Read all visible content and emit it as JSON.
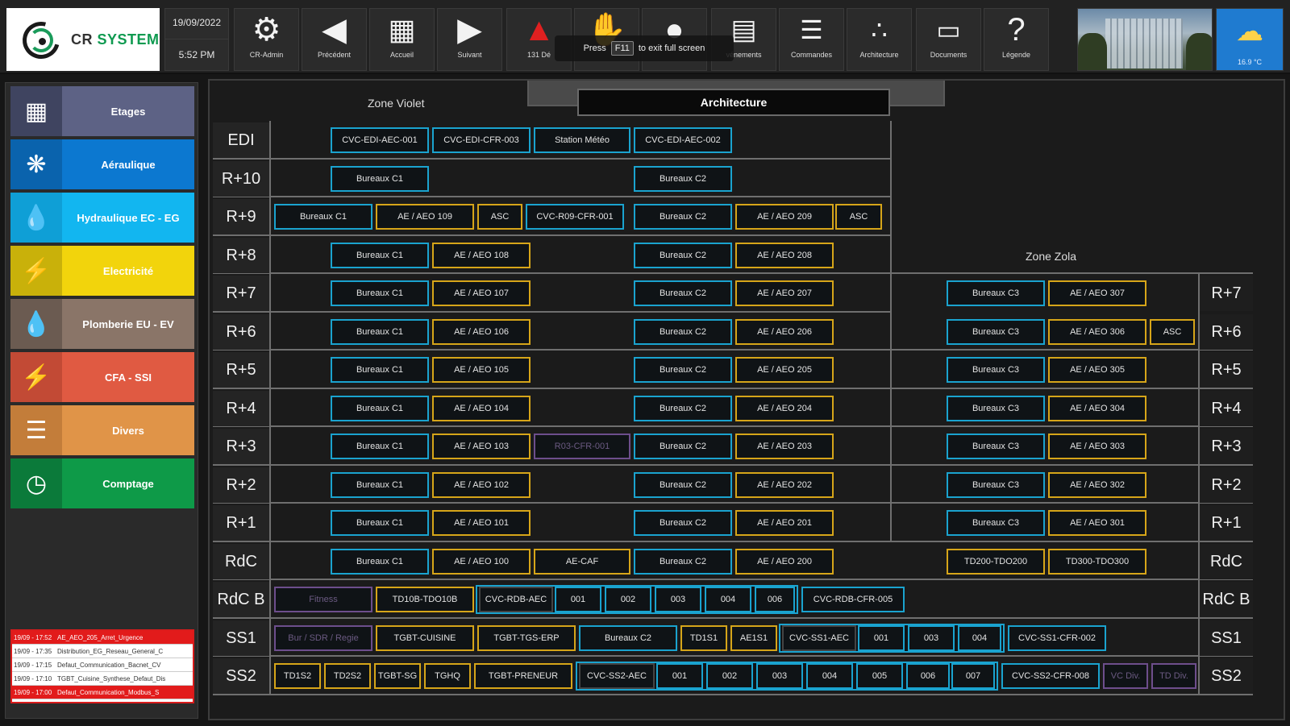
{
  "header": {
    "logo_text_cr": "CR",
    "logo_text_system": "SYSTEM",
    "date": "19/09/2022",
    "time": "5:52 PM",
    "buttons": [
      {
        "label": "CR-Admin",
        "icon": "admin-icon"
      },
      {
        "label": "Précédent",
        "icon": "back-arrow-icon"
      },
      {
        "label": "Accueil",
        "icon": "monitor-icon"
      },
      {
        "label": "Suivant",
        "icon": "forward-arrow-icon"
      },
      {
        "label": "131 Dé",
        "icon": "alarm-bell-icon"
      },
      {
        "label": "",
        "icon": "hand-icon"
      },
      {
        "label": "",
        "icon": "bell-icon"
      },
      {
        "label": "vénements",
        "icon": "clipboard-icon"
      },
      {
        "label": "Commandes",
        "icon": "sliders-icon"
      },
      {
        "label": "Architecture",
        "icon": "network-icon"
      },
      {
        "label": "Documents",
        "icon": "folder-icon"
      },
      {
        "label": "Légende",
        "icon": "question-icon"
      }
    ],
    "weather_temp": "16.9 °C",
    "f11_press": "Press",
    "f11_key": "F11",
    "f11_rest": "to exit full screen"
  },
  "sidebar": {
    "items": [
      {
        "label": "Etages",
        "icon": "building-icon",
        "icon_bg": "#3f4460",
        "bg": "#5d6285"
      },
      {
        "label": "Aéraulique",
        "icon": "fan-icon",
        "icon_bg": "#0a63ad",
        "bg": "#0c78d0"
      },
      {
        "label": "Hydraulique EC - EG",
        "icon": "drop-icon",
        "icon_bg": "#0f9fd6",
        "bg": "#12b6f0"
      },
      {
        "label": "Electricité",
        "icon": "lightning-icon",
        "icon_bg": "#c9b10a",
        "bg": "#f2d40c"
      },
      {
        "label": "Plomberie EU - EV",
        "icon": "drop-icon",
        "icon_bg": "#6b5b51",
        "bg": "#8a7568"
      },
      {
        "label": "CFA - SSI",
        "icon": "lightning-icon",
        "icon_bg": "#c24a35",
        "bg": "#e05a42"
      },
      {
        "label": "Divers",
        "icon": "list-icon",
        "icon_bg": "#c37d3a",
        "bg": "#e09448"
      },
      {
        "label": "Comptage",
        "icon": "gauge-icon",
        "icon_bg": "#0b7a3a",
        "bg": "#0e9a48"
      }
    ],
    "alarms": [
      {
        "time": "19/09 - 17:52",
        "text": "AE_AEO_205_Arret_Urgence",
        "red": true
      },
      {
        "time": "19/09 - 17:35",
        "text": "Distribution_EG_Reseau_General_C",
        "red": false
      },
      {
        "time": "19/09 - 17:15",
        "text": "Defaut_Communication_Bacnet_CV",
        "red": false
      },
      {
        "time": "19/09 - 17:10",
        "text": "TGBT_Cuisine_Synthese_Defaut_Dis",
        "red": false
      },
      {
        "time": "19/09 - 17:00",
        "text": "Defaut_Communication_Modbus_S",
        "red": true
      }
    ]
  },
  "main": {
    "tab": "Architecture",
    "zone_violet": "Zone Violet",
    "zone_zola": "Zone Zola",
    "floors": [
      "EDI",
      "R+10",
      "R+9",
      "R+8",
      "R+7",
      "R+6",
      "R+5",
      "R+4",
      "R+3",
      "R+2",
      "R+1",
      "RdC",
      "RdC B",
      "SS1",
      "SS2"
    ],
    "right_floors": [
      "R+7",
      "R+6",
      "R+5",
      "R+4",
      "R+3",
      "R+2",
      "R+1",
      "RdC",
      "RdC B",
      "SS1",
      "SS2"
    ],
    "cells": {
      "edi": [
        "CVC-EDI-AEC-001",
        "CVC-EDI-CFR-003",
        "Station Météo",
        "CVC-EDI-AEC-002"
      ],
      "r10": [
        "Bureaux C1",
        "Bureaux C2"
      ],
      "r9": [
        "Bureaux C1",
        "AE / AEO 109",
        "ASC",
        "CVC-R09-CFR-001",
        "Bureaux C2",
        "AE / AEO 209",
        "ASC"
      ],
      "r8": [
        "Bureaux C1",
        "AE / AEO 108",
        "Bureaux C2",
        "AE / AEO 208"
      ],
      "r7": [
        "Bureaux C1",
        "AE / AEO 107",
        "Bureaux C2",
        "AE / AEO 207",
        "Bureaux C3",
        "AE / AEO 307"
      ],
      "r6": [
        "Bureaux C1",
        "AE / AEO 106",
        "Bureaux C2",
        "AE / AEO 206",
        "Bureaux C3",
        "AE / AEO 306",
        "ASC"
      ],
      "r5": [
        "Bureaux C1",
        "AE / AEO 105",
        "Bureaux C2",
        "AE / AEO 205",
        "Bureaux C3",
        "AE / AEO 305"
      ],
      "r4": [
        "Bureaux C1",
        "AE / AEO 104",
        "Bureaux C2",
        "AE / AEO 204",
        "Bureaux C3",
        "AE / AEO 304"
      ],
      "r3": [
        "Bureaux C1",
        "AE / AEO 103",
        "R03-CFR-001",
        "Bureaux C2",
        "AE / AEO 203",
        "Bureaux C3",
        "AE / AEO 303"
      ],
      "r2": [
        "Bureaux C1",
        "AE / AEO 102",
        "Bureaux C2",
        "AE / AEO 202",
        "Bureaux C3",
        "AE / AEO 302"
      ],
      "r1": [
        "Bureaux C1",
        "AE / AEO 101",
        "Bureaux C2",
        "AE / AEO 201",
        "Bureaux C3",
        "AE / AEO 301"
      ],
      "rdc": [
        "Bureaux C1",
        "AE / AEO 100",
        "AE-CAF",
        "Bureaux C2",
        "AE / AEO 200",
        "TD200-TDO200",
        "TD300-TDO300"
      ],
      "rdcb": [
        "Fitness",
        "TD10B-TDO10B",
        "CVC-RDB-AEC",
        "001",
        "002",
        "003",
        "004",
        "006",
        "CVC-RDB-CFR-005"
      ],
      "ss1": [
        "Bur / SDR / Regie",
        "TGBT-CUISINE",
        "TGBT-TGS-ERP",
        "Bureaux C2",
        "TD1S1",
        "AE1S1",
        "CVC-SS1-AEC",
        "001",
        "003",
        "004",
        "CVC-SS1-CFR-002"
      ],
      "ss2": [
        "TD1S2",
        "TD2S2",
        "TGBT-SG",
        "TGHQ",
        "TGBT-PRENEUR",
        "CVC-SS2-AEC",
        "001",
        "002",
        "003",
        "004",
        "005",
        "006",
        "007",
        "CVC-SS2-CFR-008",
        "VC Div.",
        "TD Div."
      ]
    }
  }
}
